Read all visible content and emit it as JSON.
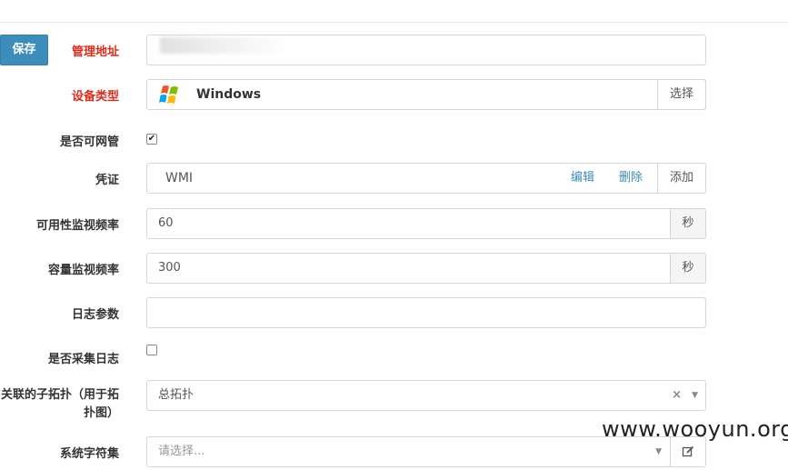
{
  "toolbar": {
    "save_label": "保存"
  },
  "form": {
    "management_address": {
      "label": "管理地址"
    },
    "device_type": {
      "label": "设备类型",
      "value": "Windows",
      "select_label": "选择",
      "logo_icon": "windows-logo-icon"
    },
    "manageable": {
      "label": "是否可网管",
      "checked": true,
      "check_glyph": "✔"
    },
    "credential": {
      "label": "凭证",
      "value": "WMI",
      "edit_label": "编辑",
      "delete_label": "删除",
      "add_label": "添加"
    },
    "availability_interval": {
      "label": "可用性监视频率",
      "value": "60",
      "unit": "秒"
    },
    "capacity_interval": {
      "label": "容量监视频率",
      "value": "300",
      "unit": "秒"
    },
    "log_params": {
      "label": "日志参数",
      "value": ""
    },
    "collect_logs": {
      "label": "是否采集日志",
      "checked": false
    },
    "topology": {
      "label": "关联的子拓扑（用于拓扑图）",
      "value": "总拓扑",
      "clear_glyph": "×",
      "caret_glyph": "▼"
    },
    "charset": {
      "label": "系统字符集",
      "placeholder": "请选择...",
      "caret_glyph": "▼",
      "edit_icon": "edit-icon"
    }
  },
  "watermark": "www.wooyun.org",
  "colors": {
    "accent": "#3c8dbc",
    "required_label": "#dd2c1c"
  }
}
